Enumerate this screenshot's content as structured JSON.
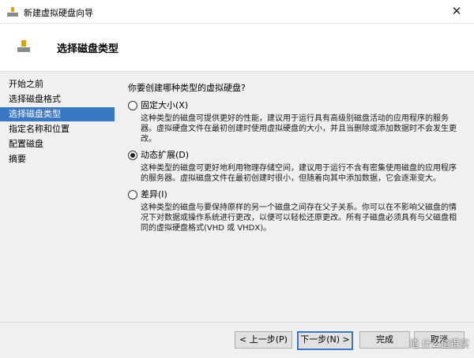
{
  "window": {
    "title": "新建虚拟硬盘向导",
    "close_glyph": "✕"
  },
  "header": {
    "title": "选择磁盘类型"
  },
  "sidebar": {
    "items": [
      {
        "label": "开始之前"
      },
      {
        "label": "选择磁盘格式"
      },
      {
        "label": "选择磁盘类型"
      },
      {
        "label": "指定名称和位置"
      },
      {
        "label": "配置磁盘"
      },
      {
        "label": "摘要"
      }
    ],
    "active_index": 2
  },
  "main": {
    "question": "你要创建哪种类型的虚拟硬盘?",
    "options": [
      {
        "label": "固定大小(X)",
        "checked": false,
        "description": "这种类型的磁盘可提供更好的性能，建议用于运行具有高级别磁盘活动的应用程序的服务器。虚拟硬盘文件在最初创建时使用虚拟硬盘的大小，并且当删除或添加数据时不会发生更改。"
      },
      {
        "label": "动态扩展(D)",
        "checked": true,
        "description": "这种类型的磁盘可更好地利用物理存储空间，建议用于运行不含有密集使用磁盘的应用程序的服务器。虚拟磁盘文件在最初创建时很小，但随着向其中添加数据，它会逐渐变大。"
      },
      {
        "label": "差异(I)",
        "checked": false,
        "description": "这种类型的磁盘与要保持原样的另一个磁盘之间存在父子关系。你可以在不影响父磁盘的情况下对数据或操作系统进行更改，以便可以轻松还原更改。所有子磁盘必须具有与父磁盘相同的虚拟硬盘格式(VHD 或 VHDX)。"
      }
    ]
  },
  "footer": {
    "prev": "< 上一步(P)",
    "next": "下一步(N) >",
    "finish": "完成",
    "cancel": "取消"
  },
  "watermark": "值 什么值得买",
  "colors": {
    "accent": "#3a78c4"
  }
}
